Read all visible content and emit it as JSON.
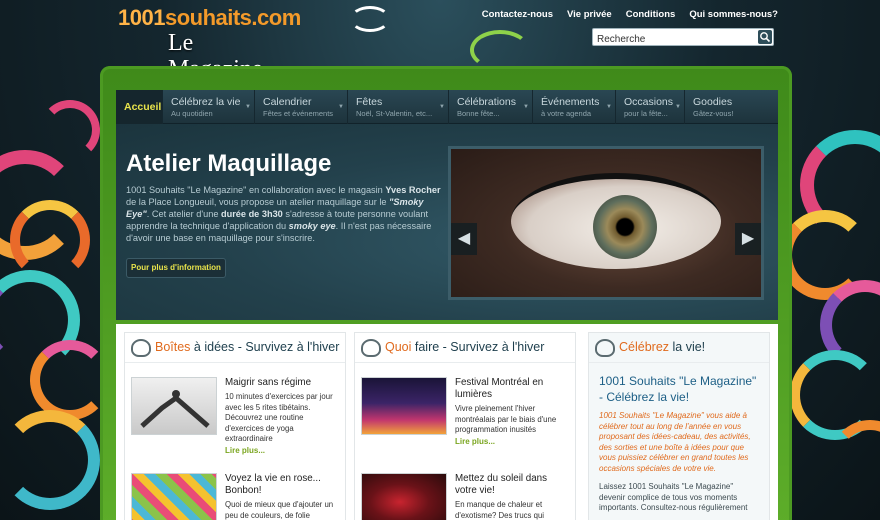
{
  "logo": {
    "top_num": "1001",
    "top_word": "souhaits.com",
    "bottom": "Le Magazine"
  },
  "toplinks": [
    "Contactez-nous",
    "Vie privée",
    "Conditions",
    "Qui sommes-nous?"
  ],
  "search": {
    "placeholder": "Recherche"
  },
  "nav": [
    {
      "title": "Accueil",
      "sub": ""
    },
    {
      "title": "Célébrez la vie",
      "sub": "Au quotidien"
    },
    {
      "title": "Calendrier",
      "sub": "Fêtes et événements"
    },
    {
      "title": "Fêtes",
      "sub": "Noël, St-Valentin, etc..."
    },
    {
      "title": "Célébrations",
      "sub": "Bonne fête..."
    },
    {
      "title": "Événements",
      "sub": "à votre agenda"
    },
    {
      "title": "Occasions",
      "sub": "pour la fête..."
    },
    {
      "title": "Goodies",
      "sub": "Gâtez-vous!"
    }
  ],
  "hero": {
    "title": "Atelier Maquillage",
    "p1": "1001 Souhaits \"Le Magazine\" en collaboration avec le magasin ",
    "b1": "Yves Rocher",
    "p2": " de la Place Longueuil, vous propose un atelier maquillage sur le ",
    "b2": "\"Smoky Eye\"",
    "p3": ". Cet atelier d'une ",
    "b3": "durée de 3h30",
    "p4": " s'adresse à toute personne voulant apprendre la technique d'application du ",
    "b4": "smoky eye",
    "p5": ". Il n'est pas nécessaire d'avoir une base en maquillage pour s'inscrire.",
    "button": "Pour plus d'information",
    "prev": "◀",
    "next": "▶"
  },
  "col1": {
    "title_hl": "Boîtes",
    "title_rest": " à idées - Survivez à l'hiver",
    "articles": [
      {
        "title": "Maigrir sans régime",
        "text": "10 minutes d'exercices par jour avec les 5 rites tibétains. Découvrez une routine d'exercices de yoga extraordinaire",
        "more": "Lire plus..."
      },
      {
        "title": "Voyez la vie en rose... Bonbon!",
        "text": "Quoi de mieux que d'ajouter un peu de couleurs, de folie",
        "more": ""
      }
    ]
  },
  "col2": {
    "title_hl": "Quoi",
    "title_rest": " faire - Survivez à l'hiver",
    "articles": [
      {
        "title": "Festival Montréal en lumières",
        "text": "Vivre pleinement l'hiver montréalais par le biais d'une programmation inusités",
        "more": "Lire plus..."
      },
      {
        "title": "Mettez du soleil dans votre vie!",
        "text": "En manque de chaleur et d'exotisme? Des trucs qui",
        "more": ""
      }
    ]
  },
  "col3": {
    "title_hl": "Célébrez",
    "title_rest": " la vie!",
    "heading": "1001 Souhaits \"Le Magazine\" - Célébrez la vie!",
    "italic": "1001 Souhaits \"Le Magazine\" vous aide à célébrer tout au long de l'année en vous proposant des idées-cadeau, des activités, des sorties et une boîte à idées pour que vous puissiez célébrer en grand toutes les occasions spéciales de votre vie.",
    "text": "Laissez 1001 Souhaits \"Le Magazine\" devenir complice de tous vos moments importants. Consultez-nous régulièrement"
  }
}
